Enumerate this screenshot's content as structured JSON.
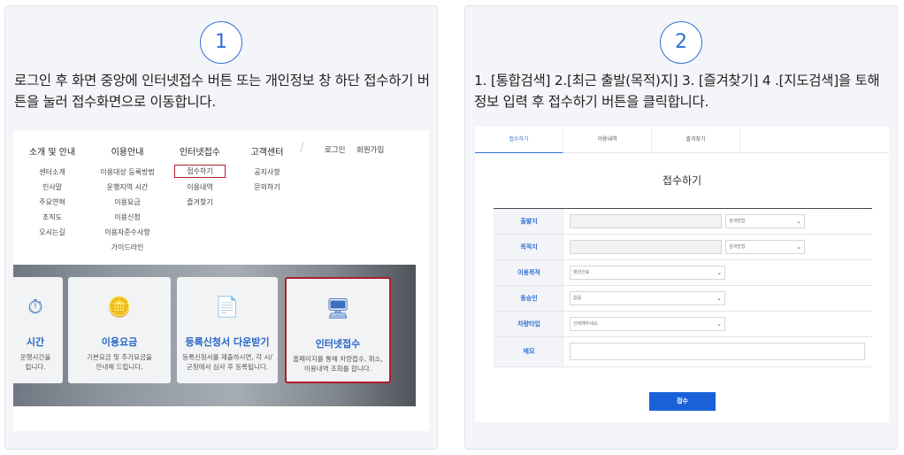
{
  "steps": [
    {
      "number": "1",
      "text": "로그인 후 화면 중앙에 인터넷접수 버튼 또는 개인정보 창 하단 접수하기 버튼을 눌러 접수화면으로 이동합니다."
    },
    {
      "number": "2",
      "text": "1. [통합검색] 2.[최근 출발(목적)지] 3. [즐겨찾기] 4 .[지도검색]을 토해 정보 입력 후 접수하기 버튼을 클릭합니다."
    }
  ],
  "menu": {
    "columns": [
      {
        "head": "소개 및 안내",
        "items": [
          "센터소개",
          "인사말",
          "주요연혁",
          "조직도",
          "오시는길"
        ]
      },
      {
        "head": "이용안내",
        "items": [
          "이용대상 등록방법",
          "운행지역 시간",
          "이용요금",
          "이용신청",
          "이용자준수사항",
          "가이드라인"
        ]
      },
      {
        "head": "인터넷접수",
        "items": [
          "접수하기",
          "이용내역",
          "즐겨찾기"
        ]
      },
      {
        "head": "고객센터",
        "items": [
          "공지사항",
          "문의하기"
        ]
      }
    ],
    "login": "로그인",
    "signup": "회원가입",
    "slash": "/"
  },
  "cards": [
    {
      "title": "시간",
      "desc": "운행시간을\n립니다."
    },
    {
      "title": "이용요금",
      "desc": "기본요금 및 추가요금을\n안내해 드립니다."
    },
    {
      "title": "등록신청서 다운받기",
      "desc": "등록신청서를 제출하시면, 각 시/\n군청에서 심사 후 등록됩니다."
    },
    {
      "title": "인터넷접수",
      "desc": "홈페이지를 통해 차량접수, 취소,\n이용내역 조회를 합니다."
    }
  ],
  "form": {
    "tabs": [
      "접수하기",
      "이용내역",
      "즐겨찾기"
    ],
    "title": "접수하기",
    "rows": [
      {
        "label": "출발지",
        "search": "검색방법"
      },
      {
        "label": "목적지",
        "search": "검색방법"
      },
      {
        "label": "이용목적",
        "select": "병원진료"
      },
      {
        "label": "동승인",
        "select": "없음"
      },
      {
        "label": "차량타입",
        "select": "선택해주세요."
      },
      {
        "label": "메모"
      }
    ],
    "submit": "접수"
  },
  "colors": {
    "accent": "#2f6fd6",
    "highlight": "#b01d2a",
    "submit": "#1a61d9"
  }
}
